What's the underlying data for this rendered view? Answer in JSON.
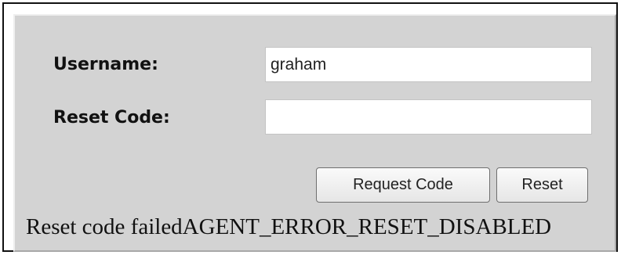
{
  "form": {
    "username_label": "Username:",
    "username_value": "graham",
    "reset_code_label": "Reset Code:",
    "reset_code_value": ""
  },
  "buttons": {
    "request_code_label": "Request Code",
    "reset_label": "Reset"
  },
  "status": {
    "message": "Reset code failedAGENT_ERROR_RESET_DISABLED"
  }
}
